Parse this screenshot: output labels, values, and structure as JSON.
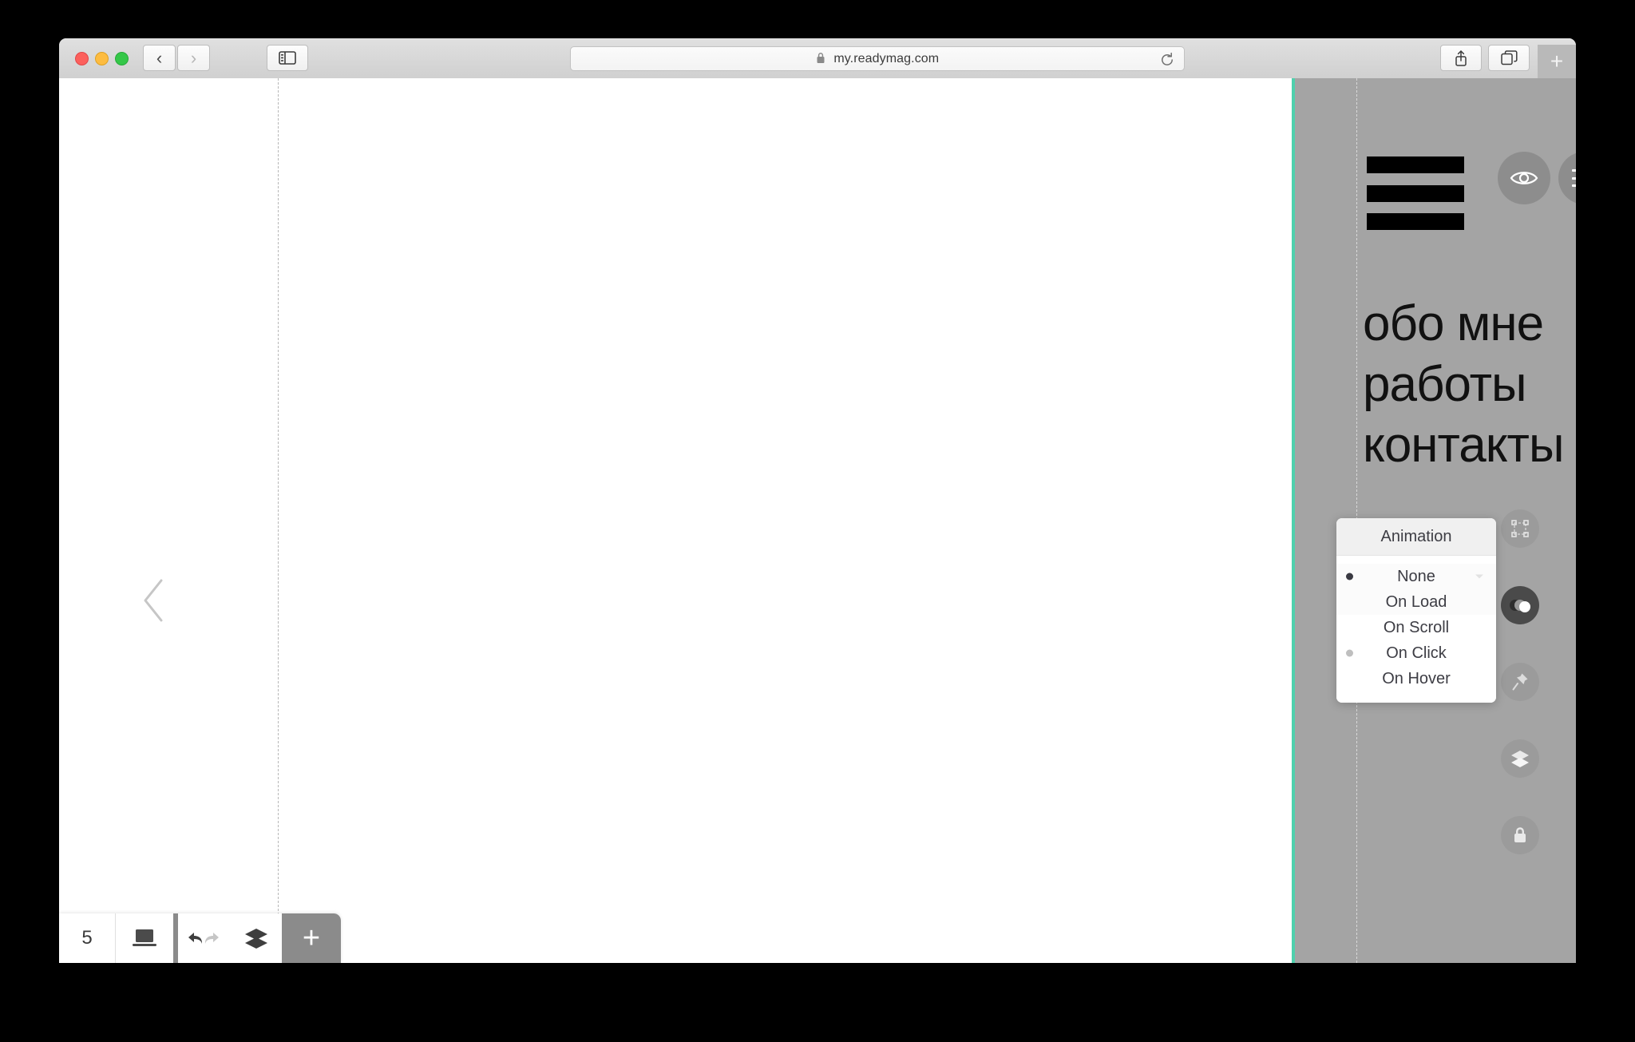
{
  "browser": {
    "url": "my.readymag.com",
    "lock_icon": "lock-icon",
    "reload_icon": "reload-icon",
    "back_icon": "chevron-left-icon",
    "forward_icon": "chevron-right-icon",
    "sidebar_icon": "sidebar-toggle-icon",
    "share_icon": "share-icon",
    "tabs_icon": "show-tabs-icon",
    "newtab_label": "+"
  },
  "editor": {
    "nav_links": [
      "обо мне",
      "работы",
      "контакты"
    ],
    "hamburger_artwork": "hamburger-artwork",
    "preview_icon": "eye-icon",
    "main_menu_icon": "hamburger-menu-icon",
    "help_label": "?",
    "prev_page_icon": "chevron-left-icon",
    "accent_color": "#4fd0ad",
    "panel_color": "#a4a4a4",
    "tools": [
      {
        "name": "transform-icon",
        "active": false
      },
      {
        "name": "animation-icon",
        "active": true
      },
      {
        "name": "pin-icon",
        "active": false
      },
      {
        "name": "layers-icon",
        "active": false
      },
      {
        "name": "lock-icon",
        "active": false
      }
    ]
  },
  "animation_popup": {
    "title": "Animation",
    "options": [
      {
        "label": "None",
        "state": "selected"
      },
      {
        "label": "On Load",
        "state": "none"
      },
      {
        "label": "On Scroll",
        "state": "none"
      },
      {
        "label": "On Click",
        "state": "dimmed"
      },
      {
        "label": "On Hover",
        "state": "none"
      }
    ]
  },
  "bottom_toolbar": {
    "page_count": "5",
    "device_icon": "desktop-icon",
    "undo_icon": "undo-icon",
    "redo_icon": "redo-icon",
    "layers_icon": "layers-icon",
    "add_label": "+"
  }
}
